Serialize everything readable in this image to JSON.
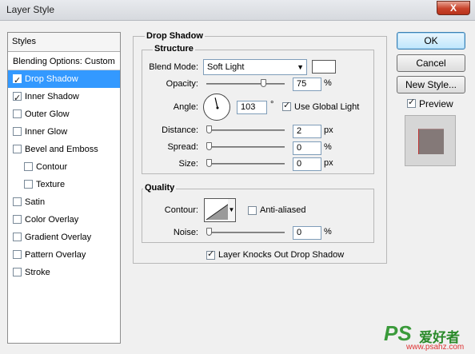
{
  "window": {
    "title": "Layer Style",
    "close_label": "X"
  },
  "styles": {
    "header": "Styles",
    "blending_options": "Blending Options: Custom",
    "items": [
      {
        "label": "Drop Shadow",
        "checked": true,
        "selected": true,
        "indent": false
      },
      {
        "label": "Inner Shadow",
        "checked": true,
        "selected": false,
        "indent": false
      },
      {
        "label": "Outer Glow",
        "checked": false,
        "selected": false,
        "indent": false
      },
      {
        "label": "Inner Glow",
        "checked": false,
        "selected": false,
        "indent": false
      },
      {
        "label": "Bevel and Emboss",
        "checked": false,
        "selected": false,
        "indent": false
      },
      {
        "label": "Contour",
        "checked": false,
        "selected": false,
        "indent": true
      },
      {
        "label": "Texture",
        "checked": false,
        "selected": false,
        "indent": true
      },
      {
        "label": "Satin",
        "checked": false,
        "selected": false,
        "indent": false
      },
      {
        "label": "Color Overlay",
        "checked": false,
        "selected": false,
        "indent": false
      },
      {
        "label": "Gradient Overlay",
        "checked": false,
        "selected": false,
        "indent": false
      },
      {
        "label": "Pattern Overlay",
        "checked": false,
        "selected": false,
        "indent": false
      },
      {
        "label": "Stroke",
        "checked": false,
        "selected": false,
        "indent": false
      }
    ]
  },
  "panel": {
    "title": "Drop Shadow",
    "structure": {
      "title": "Structure",
      "blend_mode_label": "Blend Mode:",
      "blend_mode_value": "Soft Light",
      "blend_color": "#ffffff",
      "opacity_label": "Opacity:",
      "opacity_value": "75",
      "opacity_level": 0.75,
      "opacity_unit": "%",
      "angle_label": "Angle:",
      "angle_value": "103",
      "angle_degrees": 103,
      "angle_unit": "°",
      "use_global_light_label": "Use Global Light",
      "use_global_light_checked": true,
      "distance_label": "Distance:",
      "distance_value": "2",
      "distance_level": 0.0,
      "distance_unit": "px",
      "spread_label": "Spread:",
      "spread_value": "0",
      "spread_level": 0.0,
      "spread_unit": "%",
      "size_label": "Size:",
      "size_value": "0",
      "size_level": 0.0,
      "size_unit": "px"
    },
    "quality": {
      "title": "Quality",
      "contour_label": "Contour:",
      "anti_aliased_label": "Anti-aliased",
      "anti_aliased_checked": false,
      "noise_label": "Noise:",
      "noise_value": "0",
      "noise_level": 0.0,
      "noise_unit": "%"
    },
    "layer_knocks_out_label": "Layer Knocks Out Drop Shadow",
    "layer_knocks_out_checked": true
  },
  "buttons": {
    "ok": "OK",
    "cancel": "Cancel",
    "new_style": "New Style..."
  },
  "preview": {
    "label": "Preview",
    "checked": true,
    "swatch_color": "#847978"
  },
  "watermark": {
    "brand": "PS",
    "chinese": "爱好者",
    "url": "www.psahz.com"
  }
}
